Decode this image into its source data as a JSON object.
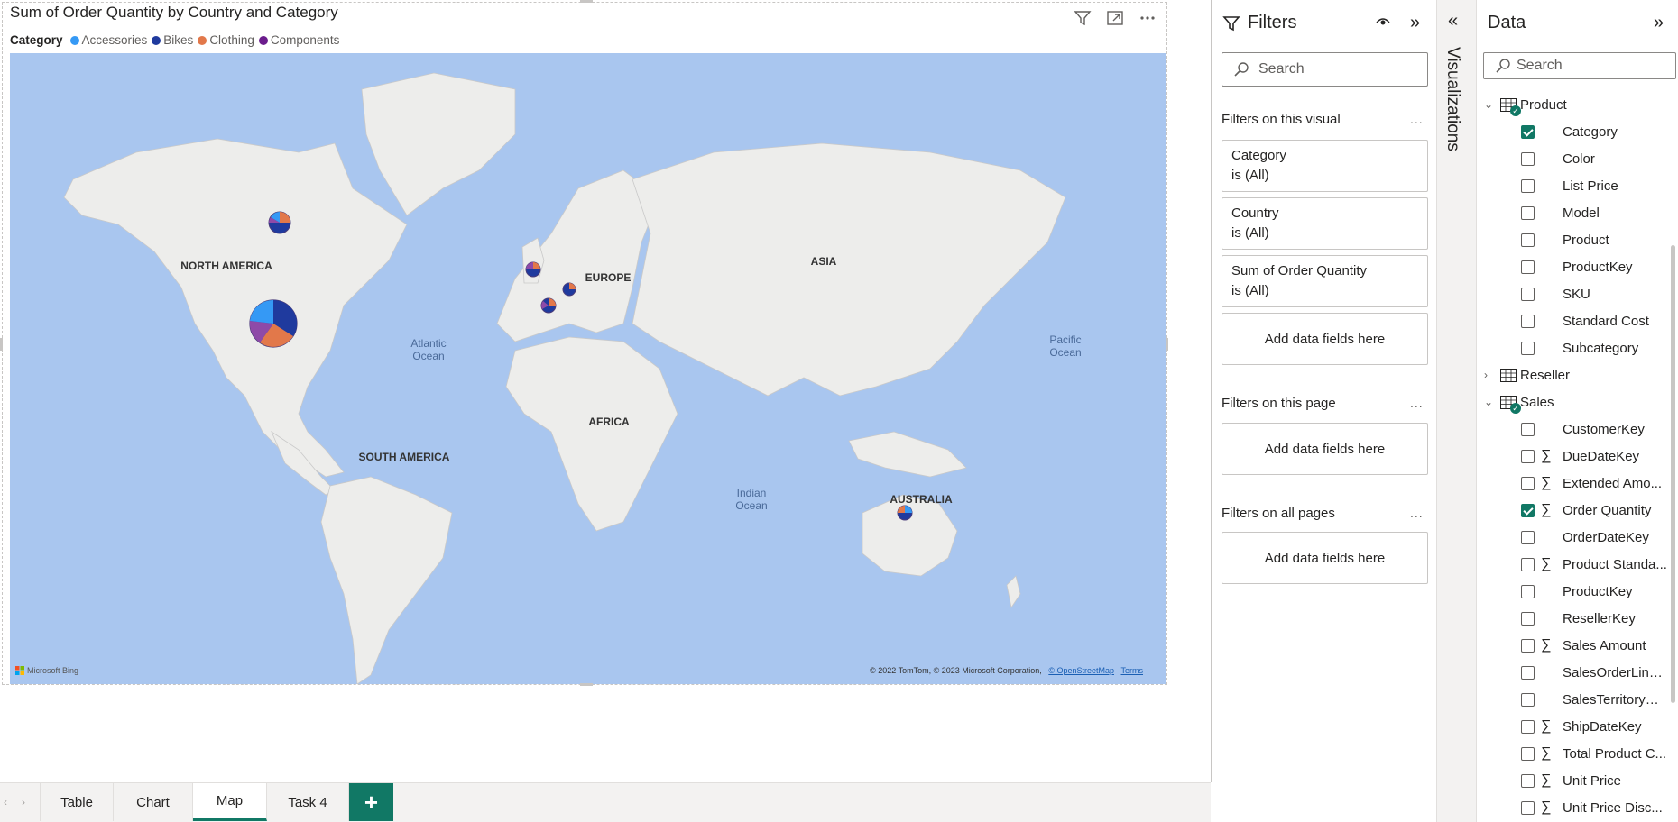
{
  "visual": {
    "title": "Sum of Order Quantity by Country and Category",
    "legend": {
      "title": "Category",
      "items": [
        {
          "label": "Accessories",
          "color": "#3599f5"
        },
        {
          "label": "Bikes",
          "color": "#1f3a9e"
        },
        {
          "label": "Clothing",
          "color": "#e2784a"
        },
        {
          "label": "Components",
          "color": "#6b1c8c"
        }
      ]
    },
    "header_icons": [
      "filter-icon",
      "focus-mode-icon",
      "more-options-icon"
    ],
    "map": {
      "ocean_color": "#a9c6ef",
      "land_color": "#ededeb",
      "labels": {
        "north_america": "NORTH AMERICA",
        "south_america": "SOUTH AMERICA",
        "europe": "EUROPE",
        "asia": "ASIA",
        "africa": "AFRICA",
        "australia": "AUSTRALIA",
        "atlantic_1": "Atlantic",
        "atlantic_2": "Ocean",
        "pacific_1": "Pacific",
        "pacific_2": "Ocean",
        "indian_1": "Indian",
        "indian_2": "Ocean"
      },
      "bing_logo": "Microsoft Bing",
      "attribution": "© 2022 TomTom, © 2023 Microsoft Corporation,",
      "attribution_osm": "© OpenStreetMap",
      "attribution_terms": "Terms"
    }
  },
  "pages": {
    "tabs": [
      {
        "label": "Table",
        "active": false
      },
      {
        "label": "Chart",
        "active": false
      },
      {
        "label": "Map",
        "active": true
      },
      {
        "label": "Task 4",
        "active": false
      }
    ],
    "add_label": "+"
  },
  "filters": {
    "title": "Filters",
    "search_placeholder": "Search",
    "on_visual_label": "Filters on this visual",
    "on_page_label": "Filters on this page",
    "on_all_label": "Filters on all pages",
    "more": "...",
    "visual_filters": [
      {
        "field": "Category",
        "value": "is (All)"
      },
      {
        "field": "Country",
        "value": "is (All)"
      },
      {
        "field": "Sum of Order Quantity",
        "value": "is (All)"
      }
    ],
    "add_fields_label": "Add data fields here"
  },
  "visualizations": {
    "label": "Visualizations"
  },
  "data_pane": {
    "title": "Data",
    "search_placeholder": "Search",
    "tables": [
      {
        "name": "Product",
        "expanded": true,
        "has_selection": true,
        "fields": [
          {
            "name": "Category",
            "checked": true,
            "sigma": false
          },
          {
            "name": "Color",
            "checked": false,
            "sigma": false
          },
          {
            "name": "List Price",
            "checked": false,
            "sigma": false
          },
          {
            "name": "Model",
            "checked": false,
            "sigma": false
          },
          {
            "name": "Product",
            "checked": false,
            "sigma": false
          },
          {
            "name": "ProductKey",
            "checked": false,
            "sigma": false
          },
          {
            "name": "SKU",
            "checked": false,
            "sigma": false
          },
          {
            "name": "Standard Cost",
            "checked": false,
            "sigma": false
          },
          {
            "name": "Subcategory",
            "checked": false,
            "sigma": false
          }
        ]
      },
      {
        "name": "Reseller",
        "expanded": false,
        "has_selection": false,
        "fields": []
      },
      {
        "name": "Sales",
        "expanded": true,
        "has_selection": true,
        "fields": [
          {
            "name": "CustomerKey",
            "checked": false,
            "sigma": false
          },
          {
            "name": "DueDateKey",
            "checked": false,
            "sigma": true
          },
          {
            "name": "Extended Amo...",
            "checked": false,
            "sigma": true
          },
          {
            "name": "Order Quantity",
            "checked": true,
            "sigma": true
          },
          {
            "name": "OrderDateKey",
            "checked": false,
            "sigma": false
          },
          {
            "name": "Product Standa...",
            "checked": false,
            "sigma": true
          },
          {
            "name": "ProductKey",
            "checked": false,
            "sigma": false
          },
          {
            "name": "ResellerKey",
            "checked": false,
            "sigma": false
          },
          {
            "name": "Sales Amount",
            "checked": false,
            "sigma": true
          },
          {
            "name": "SalesOrderLine...",
            "checked": false,
            "sigma": false
          },
          {
            "name": "SalesTerritoryKey",
            "checked": false,
            "sigma": false
          },
          {
            "name": "ShipDateKey",
            "checked": false,
            "sigma": true
          },
          {
            "name": "Total Product C...",
            "checked": false,
            "sigma": true
          },
          {
            "name": "Unit Price",
            "checked": false,
            "sigma": true
          },
          {
            "name": "Unit Price Disc...",
            "checked": false,
            "sigma": true
          }
        ]
      }
    ]
  }
}
